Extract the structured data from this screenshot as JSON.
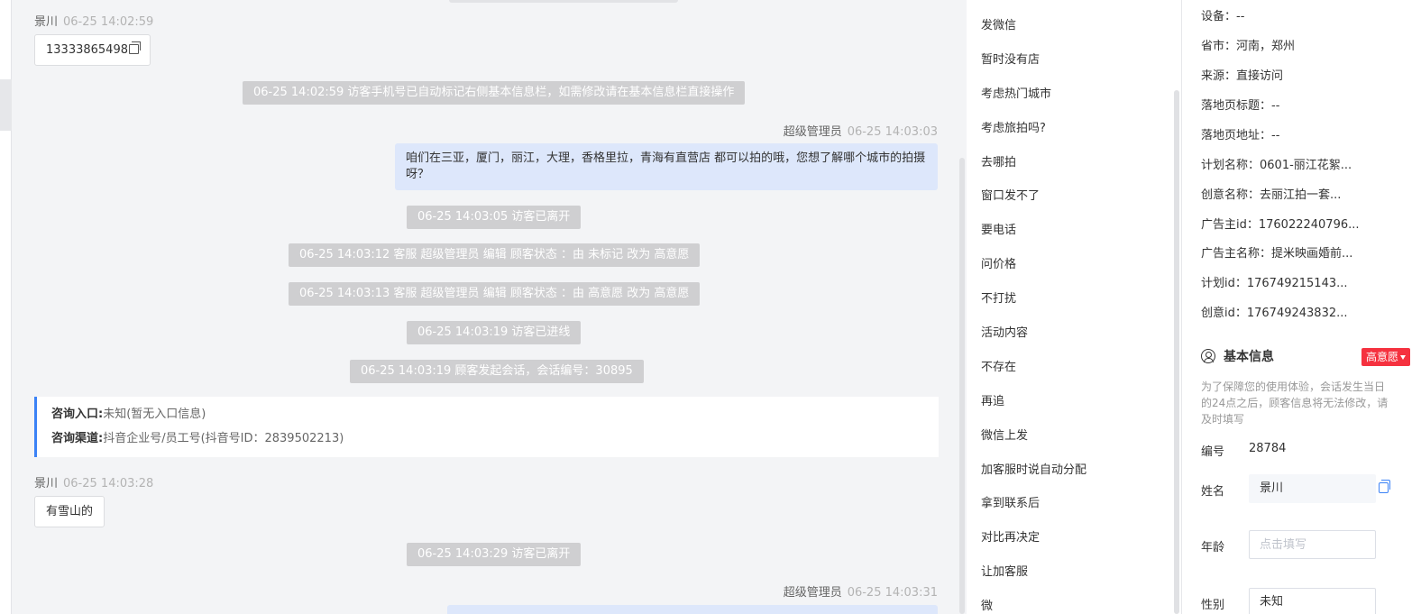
{
  "chat": {
    "messages": [
      {
        "sender": "景川",
        "time": "06-25 14:02:59",
        "text": "13333865498"
      },
      {
        "sys": "06-25 14:02:59 访客手机号已自动标记右侧基本信息栏，如需修改请在基本信息栏直接操作"
      },
      {
        "sender": "超级管理员",
        "time": "06-25 14:03:03",
        "text": "咱们在三亚，厦门，丽江，大理，香格里拉，青海有直营店 都可以拍的哦，您想了解哪个城市的拍摄呀？"
      },
      {
        "sys": "06-25 14:03:05 访客已离开"
      },
      {
        "sys": "06-25 14:03:12 客服 超级管理员 编辑 顾客状态 ：由 未标记 改为 高意愿"
      },
      {
        "sys": "06-25 14:03:13 客服 超级管理员 编辑 顾客状态 ：由 高意愿 改为 高意愿"
      },
      {
        "sys": "06-25 14:03:19 访客已进线"
      },
      {
        "sys": "06-25 14:03:19 顾客发起会话，会话编号：30895"
      },
      {
        "sender": "景川",
        "time": "06-25 14:03:28",
        "text": "有雪山的"
      },
      {
        "sys": "06-25 14:03:29 访客已离开"
      },
      {
        "sender": "超级管理员",
        "time": "06-25 14:03:31"
      }
    ],
    "consult": {
      "entry_label": "咨询入口:",
      "entry_value": "未知(暂无入口信息)",
      "channel_label": "咨询渠道:",
      "channel_value": "抖音企业号/员工号(抖音号ID：2839502213)"
    }
  },
  "quick_replies": [
    "发微信",
    "暂时没有店",
    "考虑热门城市",
    "考虑旅拍吗?",
    "去哪拍",
    "窗口发不了",
    "要电话",
    "问价格",
    "不打扰",
    "活动内容",
    "不存在",
    "再追",
    "微信上发",
    "加客服时说自动分配",
    "拿到联系后",
    "对比再决定",
    "让加客服",
    "微"
  ],
  "info": {
    "fields": [
      "设备：--",
      "省市：河南，郑州",
      "来源：直接访问",
      "落地页标题：--",
      "落地页地址：--",
      "计划名称：0601-丽江花絮...",
      "创意名称：去丽江拍一套...",
      "广告主id：176022240796...",
      "广告主名称：提米映画婚前...",
      "计划id：176749215143...",
      "创意id：176749243832..."
    ],
    "basic_title": "基本信息",
    "intent_badge": "高意愿",
    "notice": "为了保障您的使用体验，会话发生当日的24点之后，顾客信息将无法修改，请及时填写",
    "id_label": "编号",
    "id_value": "28784",
    "name_label": "姓名",
    "name_value": "景川",
    "age_label": "年龄",
    "age_placeholder": "点击填写",
    "gender_label": "性别",
    "gender_value": "未知"
  },
  "colors": {
    "accent": "#3b82f6",
    "badge": "#f5313f",
    "bubble_right": "#dde7fb",
    "system_note": "#cfcfd1"
  }
}
